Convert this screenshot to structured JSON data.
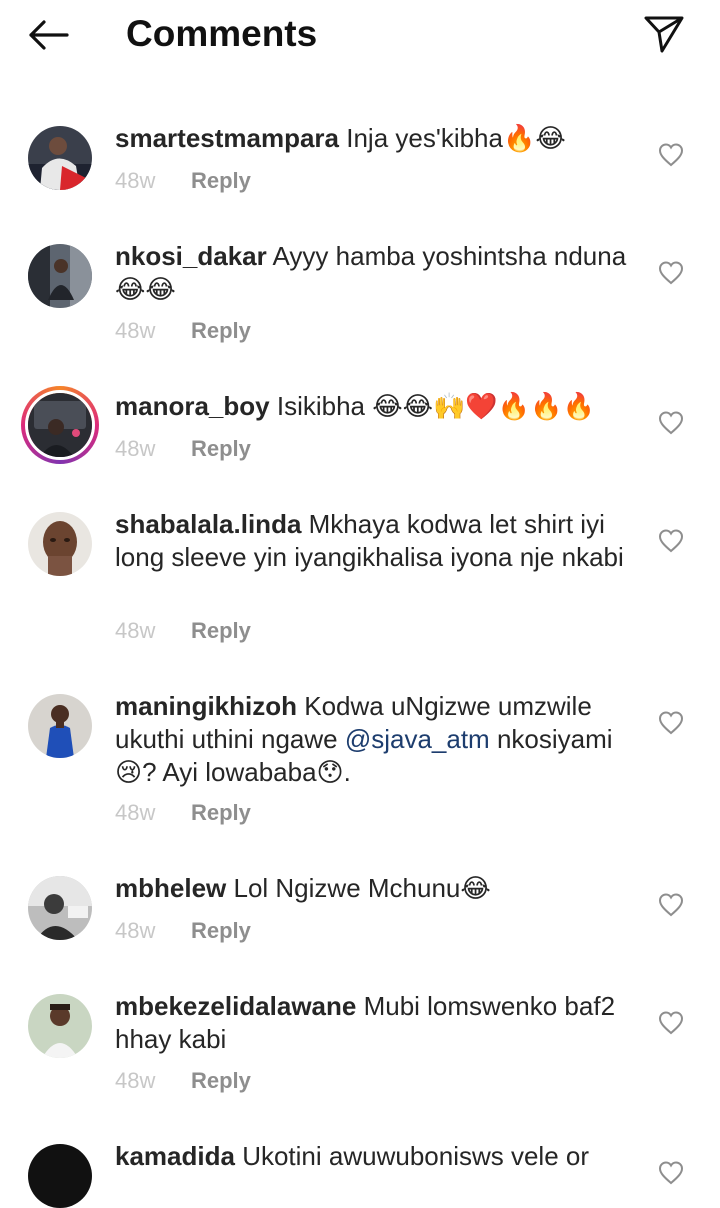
{
  "header": {
    "title": "Comments",
    "back_icon": "arrow-left-icon",
    "send_icon": "paper-plane-icon"
  },
  "colors": {
    "text": "#262626",
    "secondary": "#8e8e8e",
    "mention": "#1d3d6e"
  },
  "reply_label": "Reply",
  "comments": [
    {
      "username": "smartestmampara",
      "text": "Inja yes'kibha🔥😂",
      "time": "48w"
    },
    {
      "username": "nkosi_dakar",
      "text": "Ayyy hamba yoshintsha nduna 😂😂",
      "time": "48w"
    },
    {
      "username": "manora_boy",
      "text": "Isikibha 😂😂🙌❤️🔥🔥🔥",
      "time": "48w"
    },
    {
      "username": "shabalala.linda",
      "text": "Mkhaya kodwa let shirt iyi long sleeve yin iyangikhalisa iyona nje nkabi",
      "time": "48w"
    },
    {
      "username": "maningikhizoh",
      "text_before": "Kodwa uNgizwe umzwile ukuthi uthini ngawe ",
      "mention": "@sjava_atm",
      "text_after": " nkosiyami 😢? Ayi lowababa😯.",
      "time": "48w"
    },
    {
      "username": "mbhelew",
      "text": "Lol Ngizwe Mchunu😂",
      "time": "48w"
    },
    {
      "username": "mbekezelidalawane",
      "text": "Mubi lomswenko baf2 hhay kabi",
      "time": "48w"
    },
    {
      "username": "kamadida",
      "text": "Ukotini awuwubonisws vele or"
    }
  ]
}
